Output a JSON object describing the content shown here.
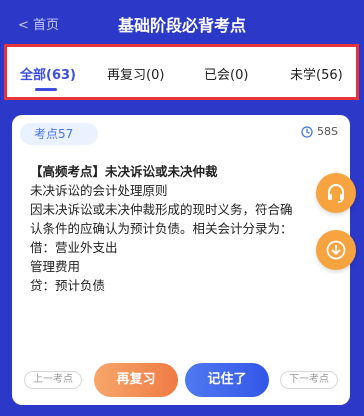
{
  "header": {
    "back_label": "< 首页",
    "title": "基础阶段必背考点"
  },
  "tabs": [
    {
      "label": "全部(63)",
      "active": true
    },
    {
      "label": "再复习(0)",
      "active": false
    },
    {
      "label": "已会(0)",
      "active": false
    },
    {
      "label": "未学(56)",
      "active": false
    }
  ],
  "card": {
    "badge": "考点57",
    "timer": "58S",
    "lines": [
      "【高频考点】未决诉讼或未决仲裁",
      "未决诉讼的会计处理原则",
      "因未决诉讼或未决仲裁形成的现时义务，符合确",
      "认条件的应确认为预计负债。相关会计分录为：",
      "借：营业外支出",
      "管理费用",
      "贷：预计负债"
    ]
  },
  "icons": {
    "headset": "headset-icon",
    "download": "download-icon",
    "timer": "clock-icon"
  },
  "actions": {
    "prev": "上一考点",
    "review": "再复习",
    "remember": "记住了",
    "next": "下一考点"
  },
  "colors": {
    "header_bg": "#2b38c8",
    "accent_blue": "#3b4ee0",
    "accent_orange": "#f7a340",
    "highlight_border": "#e8353d"
  }
}
